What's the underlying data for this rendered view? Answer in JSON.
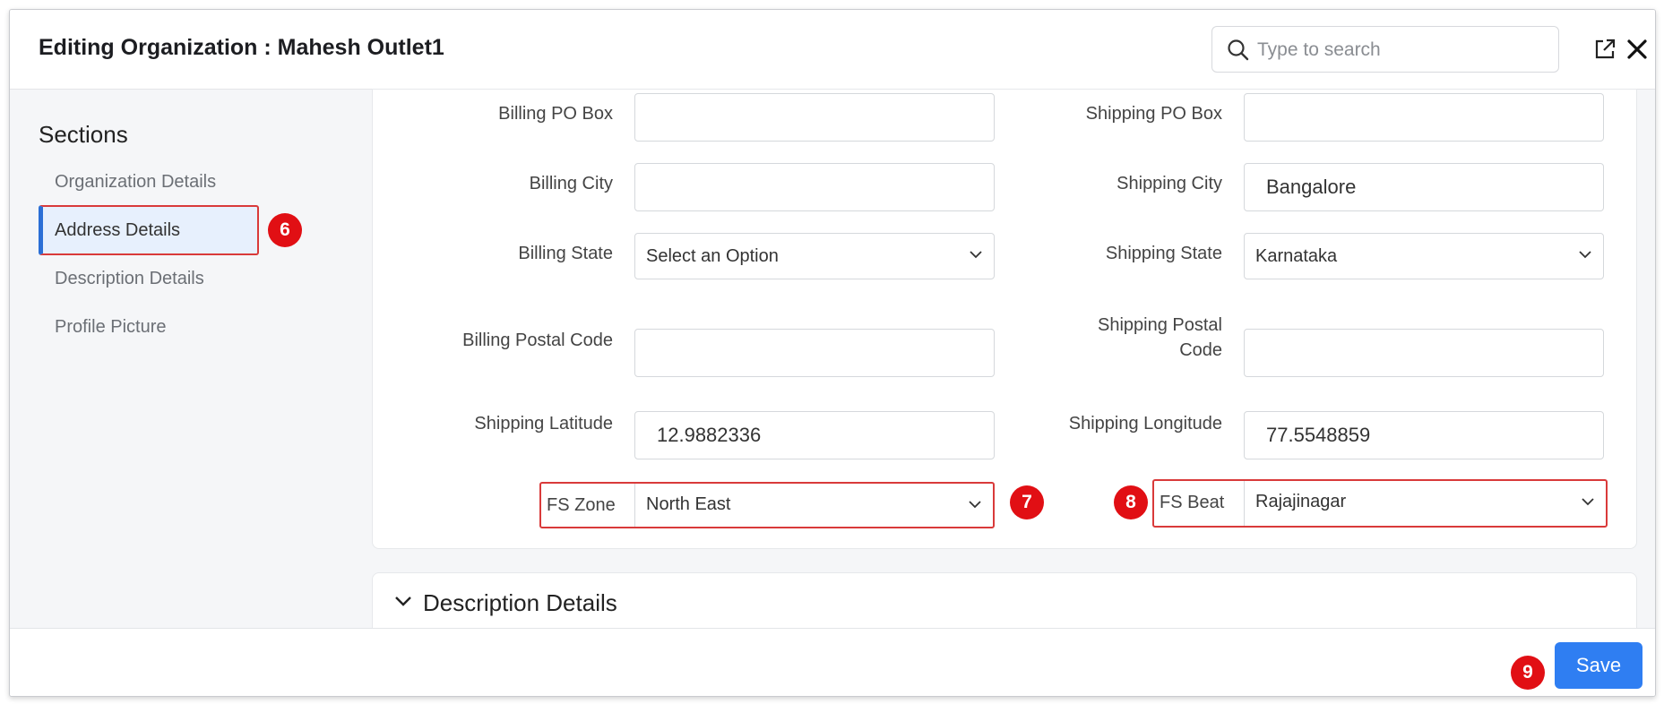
{
  "header": {
    "title": "Editing Organization : Mahesh Outlet1",
    "search_placeholder": "Type to search"
  },
  "sidebar": {
    "title": "Sections",
    "items": [
      {
        "label": "Organization Details"
      },
      {
        "label": "Address Details"
      },
      {
        "label": "Description Details"
      },
      {
        "label": "Profile Picture"
      }
    ]
  },
  "fields": {
    "billing_po_box": {
      "label": "Billing PO Box",
      "value": ""
    },
    "shipping_po_box": {
      "label": "Shipping PO Box",
      "value": ""
    },
    "billing_city": {
      "label": "Billing City",
      "value": ""
    },
    "shipping_city": {
      "label": "Shipping City",
      "value": "Bangalore"
    },
    "billing_state": {
      "label": "Billing State",
      "value": "Select an Option"
    },
    "shipping_state": {
      "label": "Shipping State",
      "value": "Karnataka"
    },
    "billing_postal_code": {
      "label": "Billing Postal Code",
      "value": ""
    },
    "shipping_postal_code": {
      "label_line1": "Shipping Postal",
      "label_line2": "Code",
      "value": ""
    },
    "shipping_latitude": {
      "label": "Shipping Latitude",
      "value": "12.9882336"
    },
    "shipping_longitude": {
      "label": "Shipping Longitude",
      "value": "77.5548859"
    },
    "fs_zone": {
      "label": "FS Zone",
      "value": "North East"
    },
    "fs_beat": {
      "label": "FS Beat",
      "value": "Rajajinagar"
    }
  },
  "description_section": {
    "title": "Description Details"
  },
  "footer": {
    "save_label": "Save"
  },
  "annotations": {
    "b6": "6",
    "b7": "7",
    "b8": "8",
    "b9": "9"
  },
  "colors": {
    "accent": "#2f7ef2",
    "highlight": "#d93a3a",
    "badge": "#e10f14",
    "active_bg": "#e7f0fd"
  }
}
